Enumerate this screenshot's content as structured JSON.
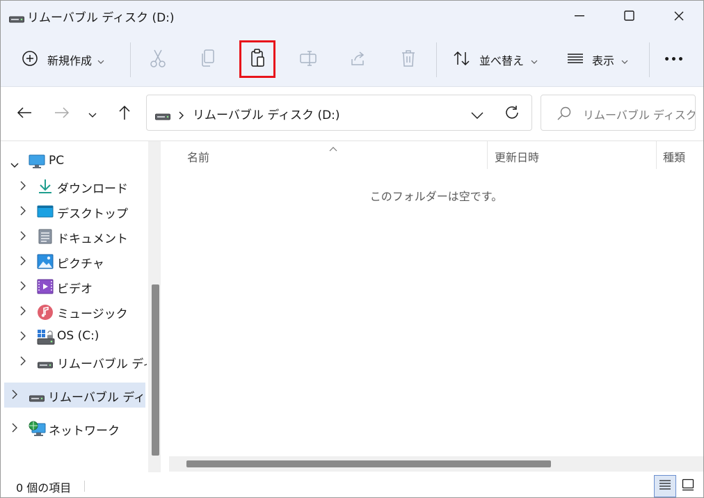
{
  "window": {
    "title": "リムーバブル ディスク (D:)"
  },
  "commandbar": {
    "new_label": "新規作成",
    "sort_label": "並べ替え",
    "view_label": "表示",
    "more_label": "•••"
  },
  "address": {
    "path_segment": "リムーバブル ディスク (D:)",
    "search_placeholder": "リムーバブル ディスク (..."
  },
  "navpane": {
    "items": [
      {
        "label": "PC"
      },
      {
        "label": "ダウンロード"
      },
      {
        "label": "デスクトップ"
      },
      {
        "label": "ドキュメント"
      },
      {
        "label": "ピクチャ"
      },
      {
        "label": "ビデオ"
      },
      {
        "label": "ミュージック"
      },
      {
        "label": "OS (C:)"
      },
      {
        "label": "リムーバブル ディスク"
      },
      {
        "label": "リムーバブル ディスク"
      },
      {
        "label": "ネットワーク"
      }
    ]
  },
  "content": {
    "columns": [
      "名前",
      "更新日時",
      "種類"
    ],
    "empty_message": "このフォルダーは空です。"
  },
  "status": {
    "item_count": "0 個の項目"
  },
  "colors": {
    "chrome_bg": "#eef2fa",
    "selection_bg": "#dce6f5",
    "highlight_border": "#e8141b",
    "disabled_icon": "#a9b4c4"
  }
}
